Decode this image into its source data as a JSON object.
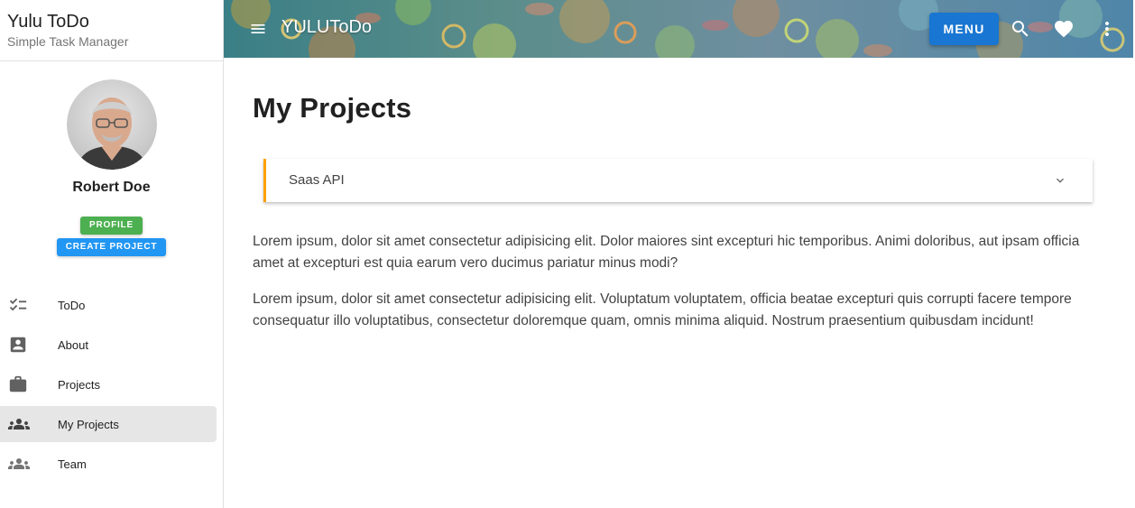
{
  "sidebar": {
    "brand_title": "Yulu ToDo",
    "brand_subtitle": "Simple Task Manager",
    "user_name": "Robert Doe",
    "profile_button": "PROFILE",
    "create_project_button": "CREATE PROJECT",
    "items": [
      {
        "label": "ToDo",
        "icon": "checklist-icon"
      },
      {
        "label": "About",
        "icon": "account-box-icon"
      },
      {
        "label": "Projects",
        "icon": "briefcase-icon"
      },
      {
        "label": "My Projects",
        "icon": "group-icon",
        "active": true
      },
      {
        "label": "Team",
        "icon": "group-icon"
      }
    ]
  },
  "topbar": {
    "app_name": "YULUToDo",
    "menu_button": "MENU",
    "icons": [
      "menu-icon",
      "search-icon",
      "heart-icon",
      "more-vert-icon"
    ]
  },
  "main": {
    "title": "My Projects",
    "panel_title": "Saas API",
    "paragraphs": [
      "Lorem ipsum, dolor sit amet consectetur adipisicing elit. Dolor maiores sint excepturi hic temporibus. Animi doloribus, aut ipsam officia amet at excepturi est quia earum vero ducimus pariatur minus modi?",
      "Lorem ipsum, dolor sit amet consectetur adipisicing elit. Voluptatum voluptatem, officia beatae excepturi quis corrupti facere tempore consequatur illo voluptatibus, consectetur doloremque quam, omnis minima aliquid. Nostrum praesentium quibusdam incidunt!"
    ]
  },
  "colors": {
    "profile_button": "#4caf50",
    "create_button": "#2196f3",
    "menu_button": "#1976d2",
    "panel_accent": "#ffa000",
    "active_nav": "#e6e6e6"
  }
}
